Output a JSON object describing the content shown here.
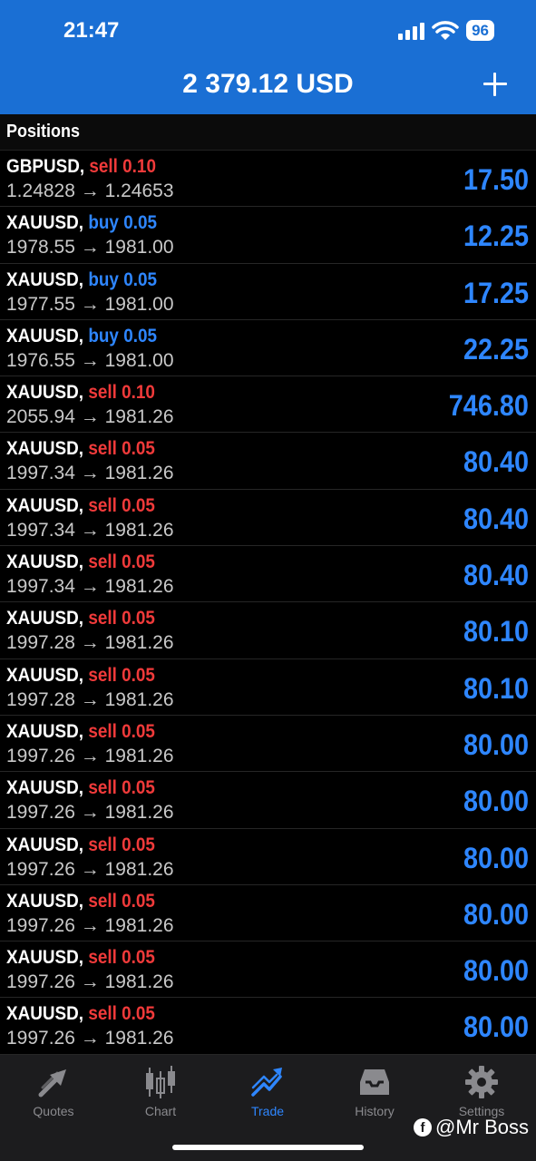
{
  "status_bar": {
    "time": "21:47",
    "battery": "96"
  },
  "header": {
    "balance": "2 379.12 USD"
  },
  "section": {
    "title": "Positions"
  },
  "positions": [
    {
      "symbol": "GBPUSD,",
      "side": "sell",
      "volume": "0.10",
      "open": "1.24828",
      "arrow": "→",
      "current": "1.24653",
      "profit": "17.50"
    },
    {
      "symbol": "XAUUSD,",
      "side": "buy",
      "volume": "0.05",
      "open": "1978.55",
      "arrow": "→",
      "current": "1981.00",
      "profit": "12.25"
    },
    {
      "symbol": "XAUUSD,",
      "side": "buy",
      "volume": "0.05",
      "open": "1977.55",
      "arrow": "→",
      "current": "1981.00",
      "profit": "17.25"
    },
    {
      "symbol": "XAUUSD,",
      "side": "buy",
      "volume": "0.05",
      "open": "1976.55",
      "arrow": "→",
      "current": "1981.00",
      "profit": "22.25"
    },
    {
      "symbol": "XAUUSD,",
      "side": "sell",
      "volume": "0.10",
      "open": "2055.94",
      "arrow": "→",
      "current": "1981.26",
      "profit": "746.80"
    },
    {
      "symbol": "XAUUSD,",
      "side": "sell",
      "volume": "0.05",
      "open": "1997.34",
      "arrow": "→",
      "current": "1981.26",
      "profit": "80.40"
    },
    {
      "symbol": "XAUUSD,",
      "side": "sell",
      "volume": "0.05",
      "open": "1997.34",
      "arrow": "→",
      "current": "1981.26",
      "profit": "80.40"
    },
    {
      "symbol": "XAUUSD,",
      "side": "sell",
      "volume": "0.05",
      "open": "1997.34",
      "arrow": "→",
      "current": "1981.26",
      "profit": "80.40"
    },
    {
      "symbol": "XAUUSD,",
      "side": "sell",
      "volume": "0.05",
      "open": "1997.28",
      "arrow": "→",
      "current": "1981.26",
      "profit": "80.10"
    },
    {
      "symbol": "XAUUSD,",
      "side": "sell",
      "volume": "0.05",
      "open": "1997.28",
      "arrow": "→",
      "current": "1981.26",
      "profit": "80.10"
    },
    {
      "symbol": "XAUUSD,",
      "side": "sell",
      "volume": "0.05",
      "open": "1997.26",
      "arrow": "→",
      "current": "1981.26",
      "profit": "80.00"
    },
    {
      "symbol": "XAUUSD,",
      "side": "sell",
      "volume": "0.05",
      "open": "1997.26",
      "arrow": "→",
      "current": "1981.26",
      "profit": "80.00"
    },
    {
      "symbol": "XAUUSD,",
      "side": "sell",
      "volume": "0.05",
      "open": "1997.26",
      "arrow": "→",
      "current": "1981.26",
      "profit": "80.00"
    },
    {
      "symbol": "XAUUSD,",
      "side": "sell",
      "volume": "0.05",
      "open": "1997.26",
      "arrow": "→",
      "current": "1981.26",
      "profit": "80.00"
    },
    {
      "symbol": "XAUUSD,",
      "side": "sell",
      "volume": "0.05",
      "open": "1997.26",
      "arrow": "→",
      "current": "1981.26",
      "profit": "80.00"
    },
    {
      "symbol": "XAUUSD,",
      "side": "sell",
      "volume": "0.05",
      "open": "1997.26",
      "arrow": "→",
      "current": "1981.26",
      "profit": "80.00"
    }
  ],
  "tabs": [
    {
      "label": "Quotes",
      "icon": "quotes-arrows-icon"
    },
    {
      "label": "Chart",
      "icon": "candlestick-chart-icon"
    },
    {
      "label": "Trade",
      "icon": "trade-trend-icon",
      "active": true
    },
    {
      "label": "History",
      "icon": "history-inbox-icon"
    },
    {
      "label": "Settings",
      "icon": "gear-icon"
    }
  ],
  "watermark": {
    "text": "@Mr Boss",
    "icon": "facebook-icon"
  },
  "colors": {
    "header_blue": "#1a6fd4",
    "sell_red": "#f03a3a",
    "buy_blue": "#2e86ff",
    "profit_blue": "#2e86ff"
  }
}
